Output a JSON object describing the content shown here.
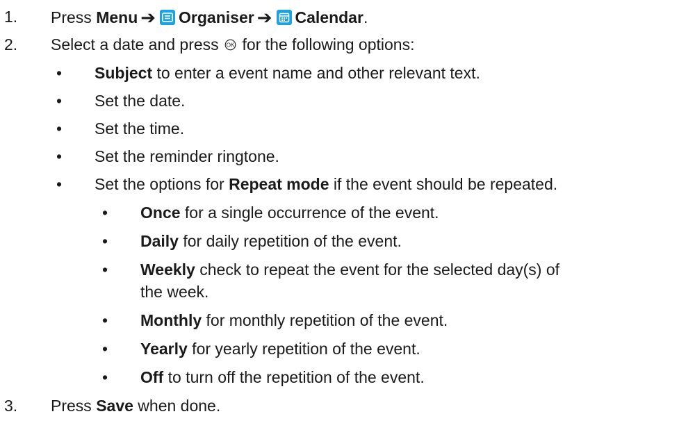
{
  "step1": {
    "number": "1.",
    "press": "Press",
    "menu": "Menu",
    "organiser_icon": "organiser-icon",
    "organiser": "Organiser",
    "calendar_icon": "calendar-icon",
    "calendar": "Calendar",
    "period": "."
  },
  "step2": {
    "number": "2.",
    "text_before": "Select a date and press",
    "ok_icon": "ok-key-icon",
    "text_after": "for the following options:",
    "options": [
      {
        "bold": "Subject",
        "text": " to enter a event name and other relevant text."
      },
      {
        "bold": "",
        "text": "Set the date."
      },
      {
        "bold": "",
        "text": "Set the time."
      },
      {
        "bold": "",
        "text": "Set the reminder ringtone."
      },
      {
        "pre": "Set the options for ",
        "bold": "Repeat mode",
        "text": " if the event should be repeated."
      }
    ],
    "repeat_modes": [
      {
        "bold": "Once",
        "text": " for a single occurrence of the event."
      },
      {
        "bold": "Daily",
        "text": " for daily repetition of the event."
      },
      {
        "bold": "Weekly",
        "text": " check to repeat the event for the selected day(s) of",
        "text2": "the week."
      },
      {
        "bold": "Monthly",
        "text": " for monthly repetition of the event."
      },
      {
        "bold": "Yearly",
        "text": " for yearly repetition of the event."
      },
      {
        "bold": "Off",
        "text": " to turn off the repetition of the event."
      }
    ]
  },
  "step3": {
    "number": "3.",
    "press": "Press",
    "save": "Save",
    "text_after": " when done."
  },
  "colors": {
    "icon_blue": "#1fa3e0",
    "text": "#1a1a1a"
  }
}
